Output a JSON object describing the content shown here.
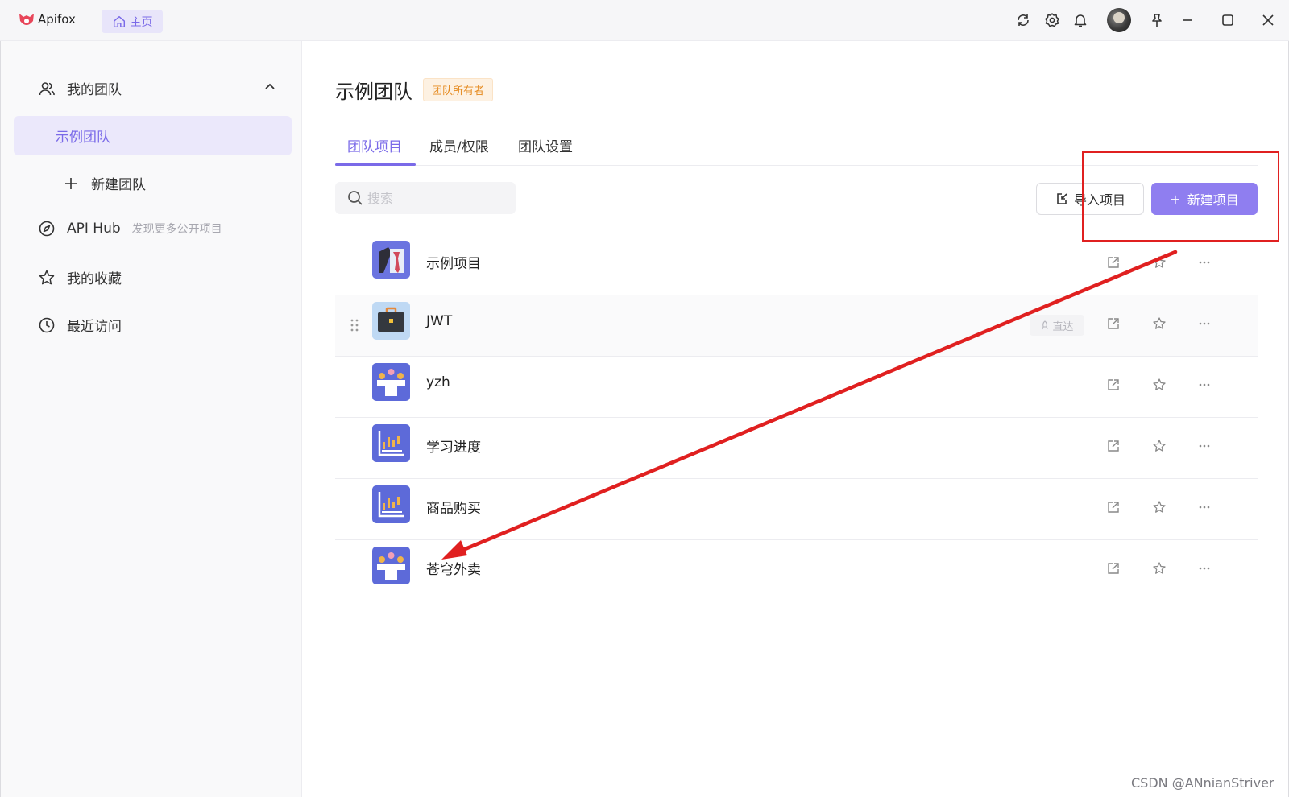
{
  "app": {
    "name": "Apifox",
    "home_tab": "主页"
  },
  "sidebar": {
    "my_teams": "我的团队",
    "active_team": "示例团队",
    "new_team": "新建团队",
    "api_hub": "API Hub",
    "api_hub_sub": "发现更多公开项目",
    "favorites": "我的收藏",
    "recent": "最近访问"
  },
  "main": {
    "team_title": "示例团队",
    "owner_badge": "团队所有者",
    "tabs": [
      {
        "label": "团队项目",
        "active": true
      },
      {
        "label": "成员/权限",
        "active": false
      },
      {
        "label": "团队设置",
        "active": false
      }
    ],
    "search_placeholder": "搜索",
    "import_label": "导入项目",
    "new_label": "新建项目",
    "projects": [
      {
        "name": "示例项目",
        "icon": "shirt-tie"
      },
      {
        "name": "JWT",
        "icon": "briefcase",
        "direct": "直达"
      },
      {
        "name": "yzh",
        "icon": "team-meeting"
      },
      {
        "name": "学习进度",
        "icon": "bar-chart"
      },
      {
        "name": "商品购买",
        "icon": "bar-chart"
      },
      {
        "name": "苍穹外卖",
        "icon": "team-meeting"
      }
    ]
  },
  "watermark": "CSDN @ANnianStriver",
  "colors": {
    "accent": "#8f7ef0",
    "annotation": "#e02020"
  }
}
